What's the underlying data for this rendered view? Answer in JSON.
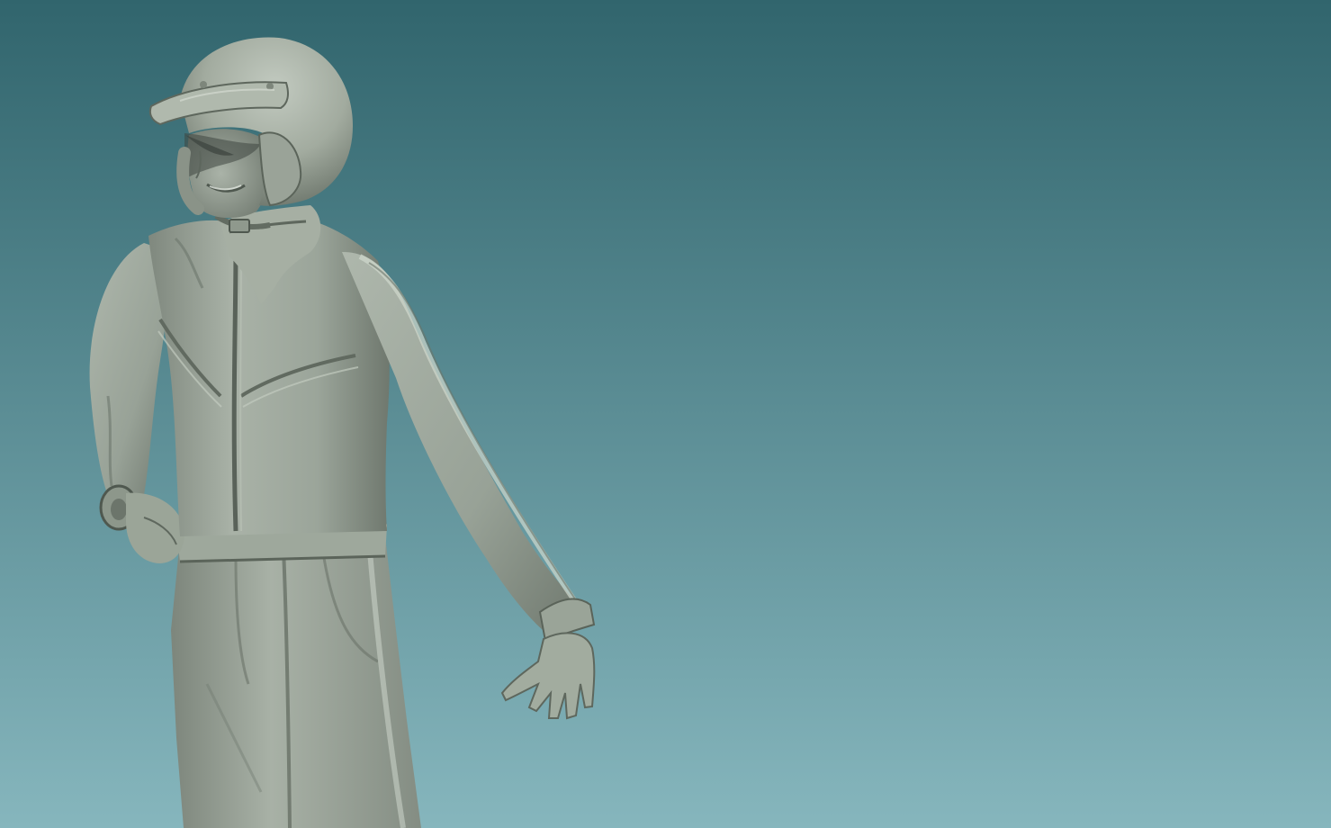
{
  "scene": {
    "subject": "racing-driver-sculpt",
    "colors": {
      "background_top": "#31656d",
      "background_bottom": "#86b6bd",
      "clay_light": "#b3bcb1",
      "clay_mid": "#929c91",
      "clay_dark": "#5d665d",
      "clay_shadow": "#3e4640"
    }
  }
}
